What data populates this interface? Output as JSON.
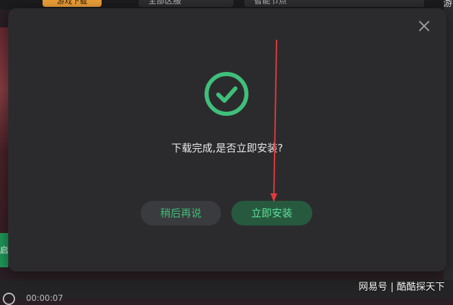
{
  "background": {
    "tab_label": "游戏下载",
    "dropdown_left": "全部区服",
    "dropdown_right": "智能节点",
    "side_text_right": "游",
    "side_text_left": "启",
    "clock": "00:00:07"
  },
  "dialog": {
    "close_icon": "close-icon",
    "status_icon": "check-circle-icon",
    "message": "下载完成,是否立即安装?",
    "later_label": "稍后再说",
    "install_label": "立即安装",
    "accent_color": "#3fbf7a",
    "annotation": "red-arrow pointing to install button"
  },
  "watermark": "网易号 | 酷酷探天下"
}
